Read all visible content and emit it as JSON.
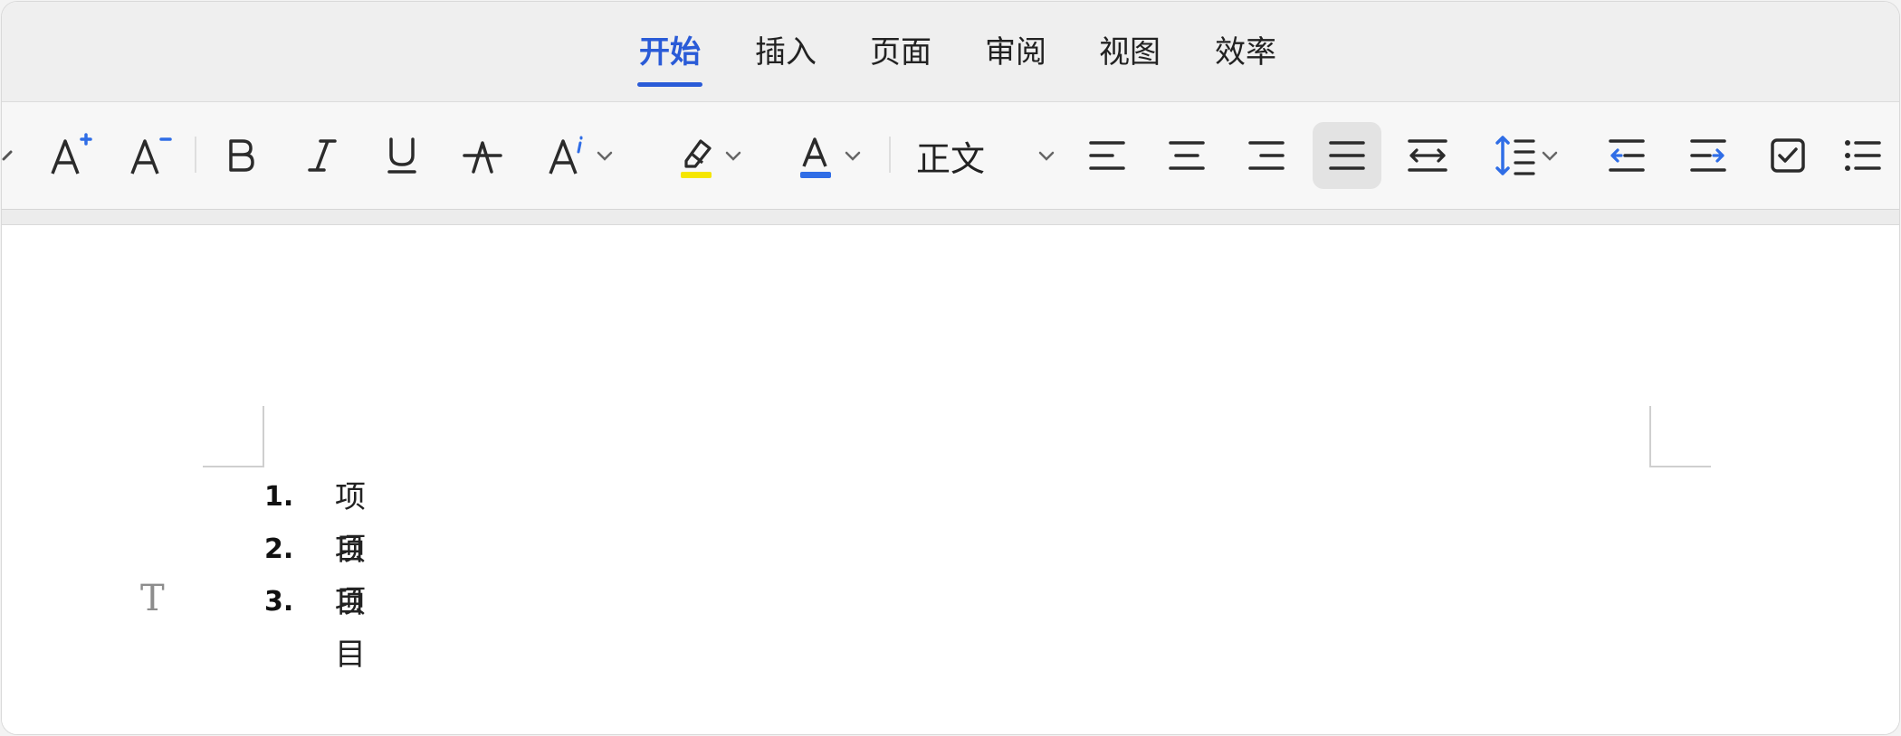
{
  "tabs": [
    {
      "label": "开始",
      "active": true
    },
    {
      "label": "插入",
      "active": false
    },
    {
      "label": "页面",
      "active": false
    },
    {
      "label": "审阅",
      "active": false
    },
    {
      "label": "视图",
      "active": false
    },
    {
      "label": "效率",
      "active": false
    }
  ],
  "toolbar": {
    "paragraph_style": "正文",
    "icons": [
      "chevron-left-icon",
      "increase-font-size-icon",
      "decrease-font-size-icon",
      "bold-icon",
      "italic-icon",
      "underline-icon",
      "strikethrough-icon",
      "text-effects-icon",
      "highlight-icon",
      "font-color-icon",
      "align-left-icon",
      "align-center-icon",
      "align-right-icon",
      "justify-icon",
      "distributed-icon",
      "line-spacing-icon",
      "decrease-indent-icon",
      "increase-indent-icon",
      "checklist-icon",
      "bullet-list-icon"
    ],
    "colors": {
      "accent": "#2a5bd7",
      "highlight": "#f5e600",
      "font_color": "#2f6de6",
      "line_spacing": "#2f6de6"
    },
    "selected_alignment": "justify"
  },
  "document": {
    "list_items": [
      {
        "number": "1.",
        "text": "项目"
      },
      {
        "number": "2.",
        "text": "项目"
      },
      {
        "number": "3.",
        "text": "项目"
      }
    ],
    "text_cursor_glyph": "T"
  }
}
